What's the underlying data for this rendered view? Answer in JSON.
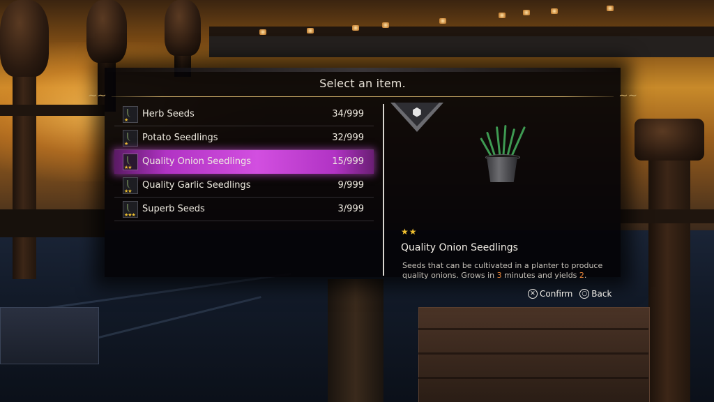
{
  "dialog": {
    "title": "Select an item."
  },
  "items": [
    {
      "name": "Herb Seeds",
      "count": "34/999",
      "stars": "★",
      "selected": false
    },
    {
      "name": "Potato Seedlings",
      "count": "32/999",
      "stars": "★",
      "selected": false
    },
    {
      "name": "Quality Onion Seedlings",
      "count": "15/999",
      "stars": "★★",
      "selected": true
    },
    {
      "name": "Quality Garlic Seedlings",
      "count": "9/999",
      "stars": "★★",
      "selected": false
    },
    {
      "name": "Superb Seeds",
      "count": "3/999",
      "stars": "★★★",
      "selected": false
    }
  ],
  "detail": {
    "category_icon": "cube-icon",
    "rarity": "★★",
    "name": "Quality Onion Seedlings",
    "desc_part1": "Seeds that can be cultivated in a planter to produce quality onions. Grows in ",
    "desc_time": "3",
    "desc_part2": " minutes and yields ",
    "desc_yield": "2",
    "desc_part3": "."
  },
  "prompts": {
    "confirm_glyph": "✕",
    "confirm_label": "Confirm",
    "back_glyph": "○",
    "back_label": "Back"
  },
  "colors": {
    "selection": "#d24fe0",
    "accent_gold": "#c8a866",
    "star": "#f0c030",
    "highlight": "#f08a3c"
  }
}
